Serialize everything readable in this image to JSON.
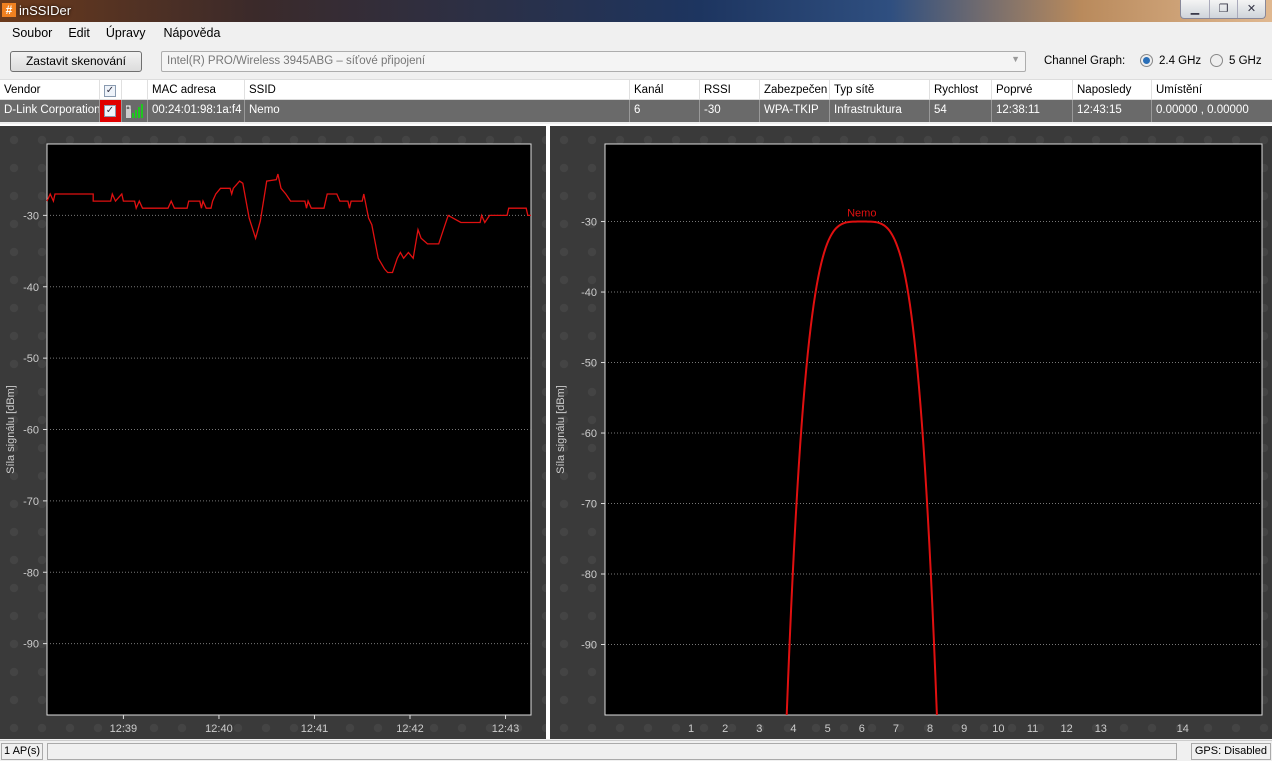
{
  "window": {
    "title": "inSSIDer",
    "logo": "#",
    "buttons": [
      "minimize",
      "restore",
      "close"
    ]
  },
  "menu": [
    "Soubor",
    "Edit",
    "Úpravy",
    "Nápověda"
  ],
  "toolbar": {
    "scan_button": "Zastavit skenování",
    "adapter": "Intel(R) PRO/Wireless 3945ABG – síťové připojení",
    "channel_graph_label": "Channel Graph:",
    "band_24": "2.4 GHz",
    "band_5": "5 GHz",
    "selected_band": "2.4 GHz"
  },
  "table": {
    "columns": [
      "Vendor",
      "",
      "",
      "MAC adresa",
      "SSID",
      "Kanál",
      "RSSI",
      "Zabezpečen",
      "Typ sítě",
      "Rychlost",
      "Poprvé",
      "Naposledy",
      "Umístění"
    ],
    "rows": [
      {
        "vendor": "D-Link Corporation",
        "checked": true,
        "signal": "signal-bars-icon",
        "mac": "00:24:01:98:1a:f4",
        "ssid": "Nemo",
        "channel": "6",
        "rssi": "-30",
        "security": "WPA-TKIP",
        "type": "Infrastruktura",
        "speed": "54",
        "first_seen": "12:38:11",
        "last_seen": "12:43:15",
        "location": "0.00000 , 0.00000"
      }
    ]
  },
  "colors": {
    "series": "#e01010",
    "plot_bg": "#000000",
    "panel_bg": "#3a3a3a",
    "selected_row": "#6a6a6a"
  },
  "chart_data": [
    {
      "type": "line",
      "title": "",
      "ylabel": "Síla signálu [dBm]",
      "xlabel": "",
      "ylim": [
        -100,
        -20
      ],
      "yticks": [
        -30,
        -40,
        -50,
        -60,
        -70,
        -80,
        -90
      ],
      "xlim_seconds_after_1238": [
        12,
        316
      ],
      "xticks": [
        {
          "label": "12:39",
          "t": 60
        },
        {
          "label": "12:40",
          "t": 120
        },
        {
          "label": "12:41",
          "t": 180
        },
        {
          "label": "12:42",
          "t": 240
        },
        {
          "label": "12:43",
          "t": 300
        }
      ],
      "series": [
        {
          "name": "Nemo",
          "points": [
            [
              12,
              -28
            ],
            [
              14,
              -27
            ],
            [
              16,
              -28
            ],
            [
              17,
              -27
            ],
            [
              41,
              -27
            ],
            [
              41,
              -28
            ],
            [
              52,
              -28
            ],
            [
              53,
              -27
            ],
            [
              55,
              -28
            ],
            [
              59,
              -27
            ],
            [
              60,
              -28
            ],
            [
              67,
              -28
            ],
            [
              68,
              -29
            ],
            [
              70,
              -28
            ],
            [
              72,
              -29
            ],
            [
              88,
              -29
            ],
            [
              90,
              -28
            ],
            [
              92,
              -29
            ],
            [
              100,
              -29
            ],
            [
              101,
              -28
            ],
            [
              108,
              -28
            ],
            [
              109,
              -29
            ],
            [
              110,
              -28
            ],
            [
              112,
              -29
            ],
            [
              115,
              -29
            ],
            [
              116,
              -28
            ],
            [
              118,
              -27
            ],
            [
              121,
              -26.2
            ],
            [
              127,
              -26.2
            ],
            [
              128,
              -27
            ],
            [
              129,
              -26.2
            ],
            [
              133,
              -25.2
            ],
            [
              135,
              -25.5
            ],
            [
              139,
              -30.4
            ],
            [
              143,
              -33.2
            ],
            [
              146,
              -30.8
            ],
            [
              150,
              -25.2
            ],
            [
              156,
              -25
            ],
            [
              157,
              -24.2
            ],
            [
              159,
              -26.2
            ],
            [
              162,
              -27
            ],
            [
              165,
              -28
            ],
            [
              174,
              -28
            ],
            [
              175,
              -29
            ],
            [
              176,
              -28
            ],
            [
              178,
              -29
            ],
            [
              186,
              -29
            ],
            [
              188,
              -27
            ],
            [
              194,
              -27
            ],
            [
              196,
              -28
            ],
            [
              201,
              -28
            ],
            [
              202,
              -29
            ],
            [
              203,
              -28
            ],
            [
              210,
              -28
            ],
            [
              211,
              -27
            ],
            [
              214,
              -30.4
            ],
            [
              216,
              -31.3
            ],
            [
              220,
              -36
            ],
            [
              224,
              -37.5
            ],
            [
              226,
              -38
            ],
            [
              229,
              -38
            ],
            [
              232,
              -36
            ],
            [
              234,
              -35.2
            ],
            [
              236,
              -36
            ],
            [
              239,
              -35.2
            ],
            [
              242,
              -36
            ],
            [
              245,
              -32
            ],
            [
              247,
              -33.2
            ],
            [
              251,
              -34
            ],
            [
              258,
              -34
            ],
            [
              261,
              -32
            ],
            [
              264,
              -30
            ],
            [
              272,
              -31
            ],
            [
              284,
              -31
            ],
            [
              285,
              -30
            ],
            [
              287,
              -31
            ],
            [
              290,
              -30
            ],
            [
              301,
              -30
            ],
            [
              302,
              -29
            ],
            [
              313,
              -29
            ],
            [
              314,
              -30
            ],
            [
              316,
              -30
            ]
          ]
        }
      ]
    },
    {
      "type": "line",
      "title": "",
      "ylabel": "Síla signálu [dBm]",
      "xlabel": "",
      "ylim": [
        -100,
        -19
      ],
      "yticks": [
        -30,
        -40,
        -50,
        -60,
        -70,
        -80,
        -90
      ],
      "xticks": [
        "1",
        "2",
        "3",
        "4",
        "5",
        "6",
        "7",
        "8",
        "9",
        "10",
        "11",
        "12",
        "13",
        "14"
      ],
      "series": [
        {
          "name": "Nemo",
          "channel": 6,
          "peak_dbm": -30,
          "half_width_channels": 2.2
        }
      ]
    }
  ],
  "status": {
    "ap_count": "1 AP(s)",
    "gps": "GPS: Disabled"
  }
}
